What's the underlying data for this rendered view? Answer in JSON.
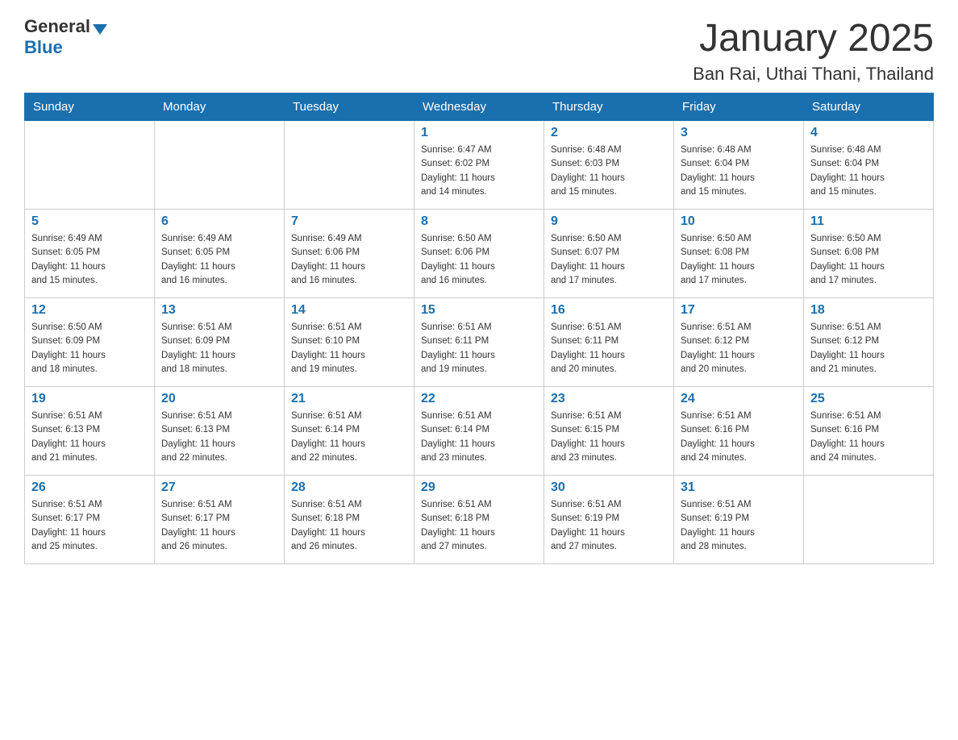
{
  "header": {
    "logo_general": "General",
    "logo_blue": "Blue",
    "month_title": "January 2025",
    "location": "Ban Rai, Uthai Thani, Thailand"
  },
  "weekdays": [
    "Sunday",
    "Monday",
    "Tuesday",
    "Wednesday",
    "Thursday",
    "Friday",
    "Saturday"
  ],
  "weeks": [
    [
      {
        "day": "",
        "info": ""
      },
      {
        "day": "",
        "info": ""
      },
      {
        "day": "",
        "info": ""
      },
      {
        "day": "1",
        "info": "Sunrise: 6:47 AM\nSunset: 6:02 PM\nDaylight: 11 hours\nand 14 minutes."
      },
      {
        "day": "2",
        "info": "Sunrise: 6:48 AM\nSunset: 6:03 PM\nDaylight: 11 hours\nand 15 minutes."
      },
      {
        "day": "3",
        "info": "Sunrise: 6:48 AM\nSunset: 6:04 PM\nDaylight: 11 hours\nand 15 minutes."
      },
      {
        "day": "4",
        "info": "Sunrise: 6:48 AM\nSunset: 6:04 PM\nDaylight: 11 hours\nand 15 minutes."
      }
    ],
    [
      {
        "day": "5",
        "info": "Sunrise: 6:49 AM\nSunset: 6:05 PM\nDaylight: 11 hours\nand 15 minutes."
      },
      {
        "day": "6",
        "info": "Sunrise: 6:49 AM\nSunset: 6:05 PM\nDaylight: 11 hours\nand 16 minutes."
      },
      {
        "day": "7",
        "info": "Sunrise: 6:49 AM\nSunset: 6:06 PM\nDaylight: 11 hours\nand 16 minutes."
      },
      {
        "day": "8",
        "info": "Sunrise: 6:50 AM\nSunset: 6:06 PM\nDaylight: 11 hours\nand 16 minutes."
      },
      {
        "day": "9",
        "info": "Sunrise: 6:50 AM\nSunset: 6:07 PM\nDaylight: 11 hours\nand 17 minutes."
      },
      {
        "day": "10",
        "info": "Sunrise: 6:50 AM\nSunset: 6:08 PM\nDaylight: 11 hours\nand 17 minutes."
      },
      {
        "day": "11",
        "info": "Sunrise: 6:50 AM\nSunset: 6:08 PM\nDaylight: 11 hours\nand 17 minutes."
      }
    ],
    [
      {
        "day": "12",
        "info": "Sunrise: 6:50 AM\nSunset: 6:09 PM\nDaylight: 11 hours\nand 18 minutes."
      },
      {
        "day": "13",
        "info": "Sunrise: 6:51 AM\nSunset: 6:09 PM\nDaylight: 11 hours\nand 18 minutes."
      },
      {
        "day": "14",
        "info": "Sunrise: 6:51 AM\nSunset: 6:10 PM\nDaylight: 11 hours\nand 19 minutes."
      },
      {
        "day": "15",
        "info": "Sunrise: 6:51 AM\nSunset: 6:11 PM\nDaylight: 11 hours\nand 19 minutes."
      },
      {
        "day": "16",
        "info": "Sunrise: 6:51 AM\nSunset: 6:11 PM\nDaylight: 11 hours\nand 20 minutes."
      },
      {
        "day": "17",
        "info": "Sunrise: 6:51 AM\nSunset: 6:12 PM\nDaylight: 11 hours\nand 20 minutes."
      },
      {
        "day": "18",
        "info": "Sunrise: 6:51 AM\nSunset: 6:12 PM\nDaylight: 11 hours\nand 21 minutes."
      }
    ],
    [
      {
        "day": "19",
        "info": "Sunrise: 6:51 AM\nSunset: 6:13 PM\nDaylight: 11 hours\nand 21 minutes."
      },
      {
        "day": "20",
        "info": "Sunrise: 6:51 AM\nSunset: 6:13 PM\nDaylight: 11 hours\nand 22 minutes."
      },
      {
        "day": "21",
        "info": "Sunrise: 6:51 AM\nSunset: 6:14 PM\nDaylight: 11 hours\nand 22 minutes."
      },
      {
        "day": "22",
        "info": "Sunrise: 6:51 AM\nSunset: 6:14 PM\nDaylight: 11 hours\nand 23 minutes."
      },
      {
        "day": "23",
        "info": "Sunrise: 6:51 AM\nSunset: 6:15 PM\nDaylight: 11 hours\nand 23 minutes."
      },
      {
        "day": "24",
        "info": "Sunrise: 6:51 AM\nSunset: 6:16 PM\nDaylight: 11 hours\nand 24 minutes."
      },
      {
        "day": "25",
        "info": "Sunrise: 6:51 AM\nSunset: 6:16 PM\nDaylight: 11 hours\nand 24 minutes."
      }
    ],
    [
      {
        "day": "26",
        "info": "Sunrise: 6:51 AM\nSunset: 6:17 PM\nDaylight: 11 hours\nand 25 minutes."
      },
      {
        "day": "27",
        "info": "Sunrise: 6:51 AM\nSunset: 6:17 PM\nDaylight: 11 hours\nand 26 minutes."
      },
      {
        "day": "28",
        "info": "Sunrise: 6:51 AM\nSunset: 6:18 PM\nDaylight: 11 hours\nand 26 minutes."
      },
      {
        "day": "29",
        "info": "Sunrise: 6:51 AM\nSunset: 6:18 PM\nDaylight: 11 hours\nand 27 minutes."
      },
      {
        "day": "30",
        "info": "Sunrise: 6:51 AM\nSunset: 6:19 PM\nDaylight: 11 hours\nand 27 minutes."
      },
      {
        "day": "31",
        "info": "Sunrise: 6:51 AM\nSunset: 6:19 PM\nDaylight: 11 hours\nand 28 minutes."
      },
      {
        "day": "",
        "info": ""
      }
    ]
  ]
}
